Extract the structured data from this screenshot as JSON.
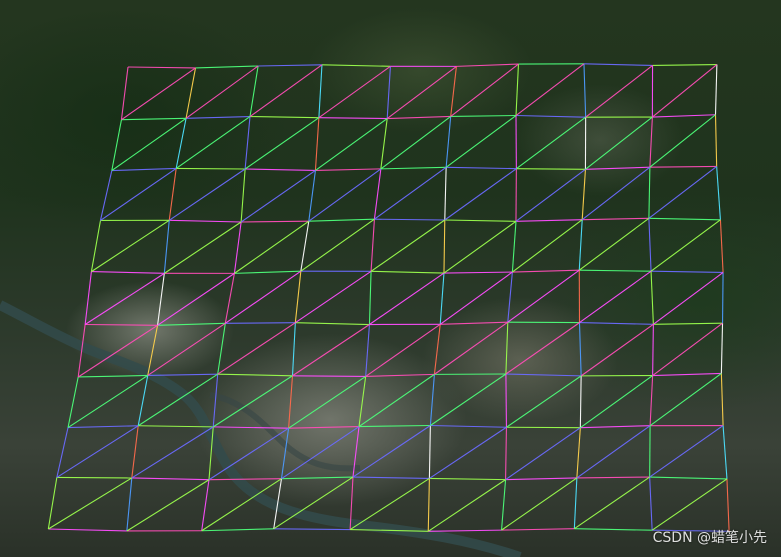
{
  "image": {
    "watermark": "CSDN @蜡笔小先",
    "description_colors": {
      "forest": "#1f331d",
      "urban": "#9a9a90",
      "river": "#355050"
    }
  }
}
